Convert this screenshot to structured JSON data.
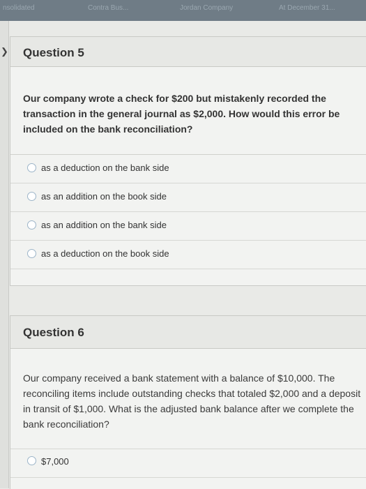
{
  "top_tabs": [
    "nsolidated",
    "Contra Bus...",
    "Jordan Company",
    "At December 31..."
  ],
  "q5": {
    "title": "Question 5",
    "text": "Our company wrote a check for $200 but mistakenly recorded the transaction in the general journal as $2,000. How would this error be included on the bank reconciliation?",
    "answers": [
      "as a deduction on the bank side",
      "as an addition on the book side",
      "as an addition on the bank side",
      "as a deduction on the book side"
    ]
  },
  "q6": {
    "title": "Question 6",
    "text": "Our company received a bank statement with a balance of $10,000. The reconciling items include outstanding checks that totaled $2,000 and a deposit in transit of $1,000. What is the adjusted bank balance after we complete the bank reconciliation?",
    "answers": [
      "$7,000"
    ]
  }
}
